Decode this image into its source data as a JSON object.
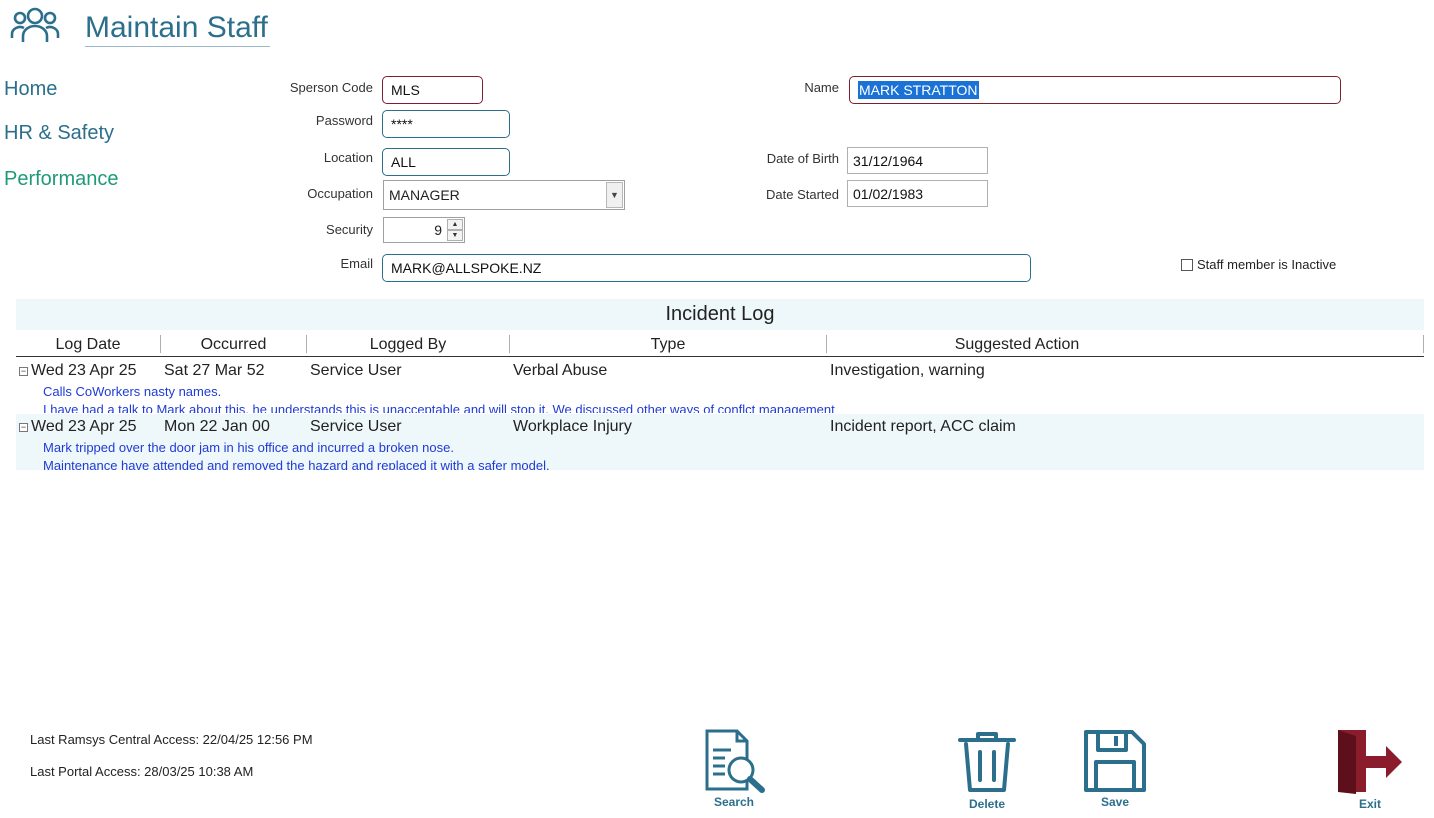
{
  "header": {
    "title": "Maintain Staff",
    "icon": "users-icon"
  },
  "nav": [
    {
      "label": "Home"
    },
    {
      "label": "HR & Safety"
    },
    {
      "label": "Performance",
      "active": true
    }
  ],
  "form": {
    "sperson_code_label": "Sperson Code",
    "sperson_code": "MLS",
    "password_label": "Password",
    "password": "****",
    "location_label": "Location",
    "location": "ALL",
    "occupation_label": "Occupation",
    "occupation": "MANAGER",
    "security_label": "Security",
    "security": "9",
    "email_label": "Email",
    "email": "MARK@ALLSPOKE.NZ",
    "name_label": "Name",
    "name": "MARK STRATTON",
    "dob_label": "Date of Birth",
    "dob": "31/12/1964",
    "started_label": "Date Started",
    "started": "01/02/1983",
    "inactive_label": "Staff member is Inactive"
  },
  "incident_log": {
    "title": "Incident Log",
    "columns": [
      "Log Date",
      "Occurred",
      "Logged By",
      "Type",
      "Suggested Action"
    ],
    "rows": [
      {
        "log_date": "Wed 23 Apr 25",
        "occurred": "Sat 27 Mar 52",
        "logged_by": "Service User",
        "type": "Verbal Abuse",
        "action": "Investigation, warning",
        "note1": "Calls CoWorkers nasty names.",
        "note2": "I have had a talk to Mark about this, he understands this is unacceptable and will stop it. We discussed other ways of conflct management"
      },
      {
        "log_date": "Wed 23 Apr 25",
        "occurred": "Mon 22 Jan 00",
        "logged_by": "Service User",
        "type": "Workplace Injury",
        "action": "Incident report, ACC claim",
        "note1": "Mark tripped over the door jam in his office and incurred a broken nose.",
        "note2": "Maintenance have attended and removed the hazard and replaced it with a safer model."
      }
    ]
  },
  "footer": {
    "central_access": "Last Ramsys Central Access: 22/04/25 12:56 PM",
    "portal_access": "Last Portal Access: 28/03/25 10:38 AM"
  },
  "toolbar": {
    "search": "Search",
    "delete": "Delete",
    "save": "Save",
    "exit": "Exit"
  },
  "colors": {
    "accent": "#2b6f8c",
    "active_nav": "#1f9a78",
    "note_text": "#1f3bd6",
    "exit_red": "#8a1c2c"
  }
}
